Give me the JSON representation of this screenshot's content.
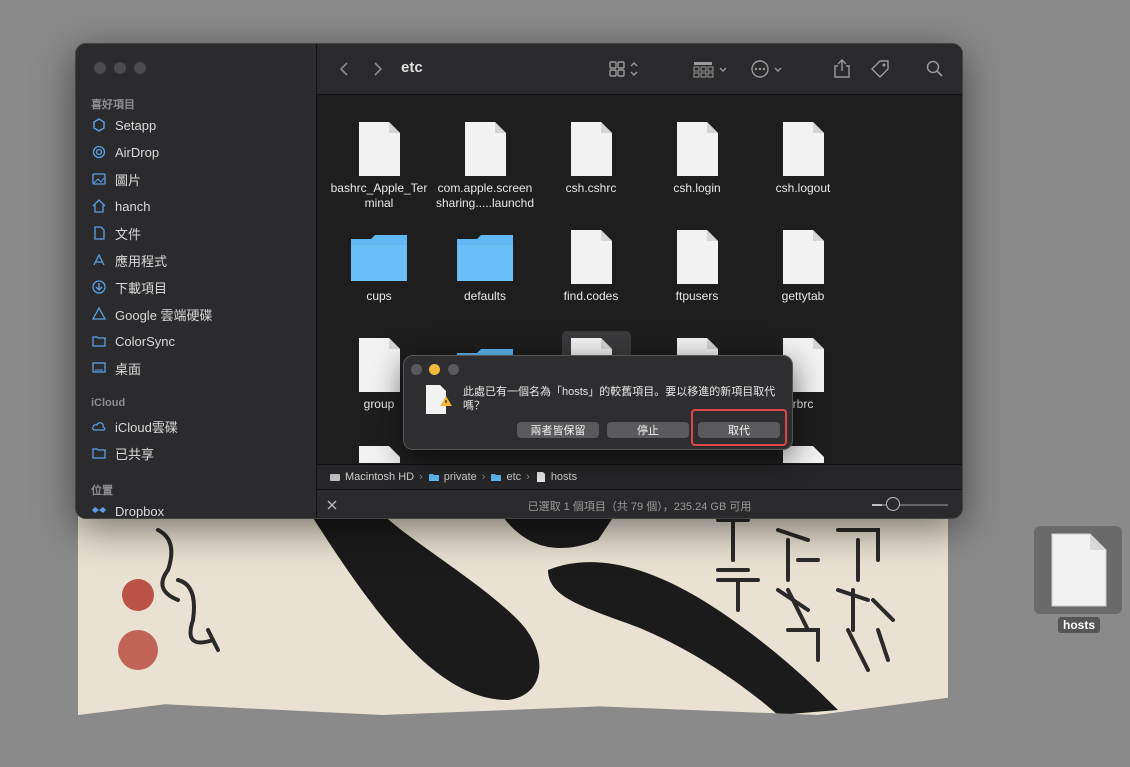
{
  "window": {
    "title": "etc"
  },
  "sidebar": {
    "favorites_header": "喜好項目",
    "favorites": [
      {
        "label": "Setapp",
        "icon": "setapp-icon"
      },
      {
        "label": "AirDrop",
        "icon": "airdrop-icon"
      },
      {
        "label": "圖片",
        "icon": "photos-icon"
      },
      {
        "label": "hanch",
        "icon": "home-icon"
      },
      {
        "label": "文件",
        "icon": "document-icon"
      },
      {
        "label": "應用程式",
        "icon": "applications-icon"
      },
      {
        "label": "下載項目",
        "icon": "downloads-icon"
      },
      {
        "label": "Google 雲端硬碟",
        "icon": "google-drive-icon"
      },
      {
        "label": "ColorSync",
        "icon": "folder-icon"
      },
      {
        "label": "桌面",
        "icon": "desktop-icon"
      }
    ],
    "icloud_header": "iCloud",
    "icloud": [
      {
        "label": "iCloud雲碟",
        "icon": "cloud-icon"
      },
      {
        "label": "已共享",
        "icon": "shared-folder-icon"
      }
    ],
    "locations_header": "位置",
    "locations": [
      {
        "label": "Dropbox",
        "icon": "dropbox-icon"
      }
    ]
  },
  "files": [
    {
      "name": "bashrc_Apple_Terminal",
      "line1": "bashrc_Apple_Ter",
      "line2": "minal",
      "type": "file"
    },
    {
      "name": "com.apple.screensharing.....launchd",
      "line1": "com.apple.screen",
      "line2": "sharing.....launchd",
      "type": "file"
    },
    {
      "name": "csh.cshrc",
      "line1": "csh.cshrc",
      "line2": "",
      "type": "file"
    },
    {
      "name": "csh.login",
      "line1": "csh.login",
      "line2": "",
      "type": "file"
    },
    {
      "name": "csh.logout",
      "line1": "csh.logout",
      "line2": "",
      "type": "file"
    },
    {
      "name": "cups",
      "line1": "cups",
      "line2": "",
      "type": "folder"
    },
    {
      "name": "defaults",
      "line1": "defaults",
      "line2": "",
      "type": "folder"
    },
    {
      "name": "find.codes",
      "line1": "find.codes",
      "line2": "",
      "type": "file"
    },
    {
      "name": "ftpusers",
      "line1": "ftpusers",
      "line2": "",
      "type": "file"
    },
    {
      "name": "gettytab",
      "line1": "gettytab",
      "line2": "",
      "type": "file"
    },
    {
      "name": "group",
      "line1": "group",
      "line2": "",
      "type": "file"
    },
    {
      "name": "rbrc",
      "line1": "rbrc",
      "line2": "",
      "type": "file"
    }
  ],
  "pathbar": [
    "Macintosh HD",
    "private",
    "etc",
    "hosts"
  ],
  "status": "已選取 1 個項目（共 79 個），235.24 GB 可用",
  "dialog": {
    "message": "此處已有一個名為「hosts」的較舊項目。要以移進的新項目取代嗎？",
    "buttons": {
      "keep_both": "兩者皆保留",
      "stop": "停止",
      "replace": "取代"
    }
  },
  "desktop": {
    "file_label": "hosts"
  },
  "colors": {
    "highlight": "#e0454a",
    "folder": "#5fb8f2"
  }
}
